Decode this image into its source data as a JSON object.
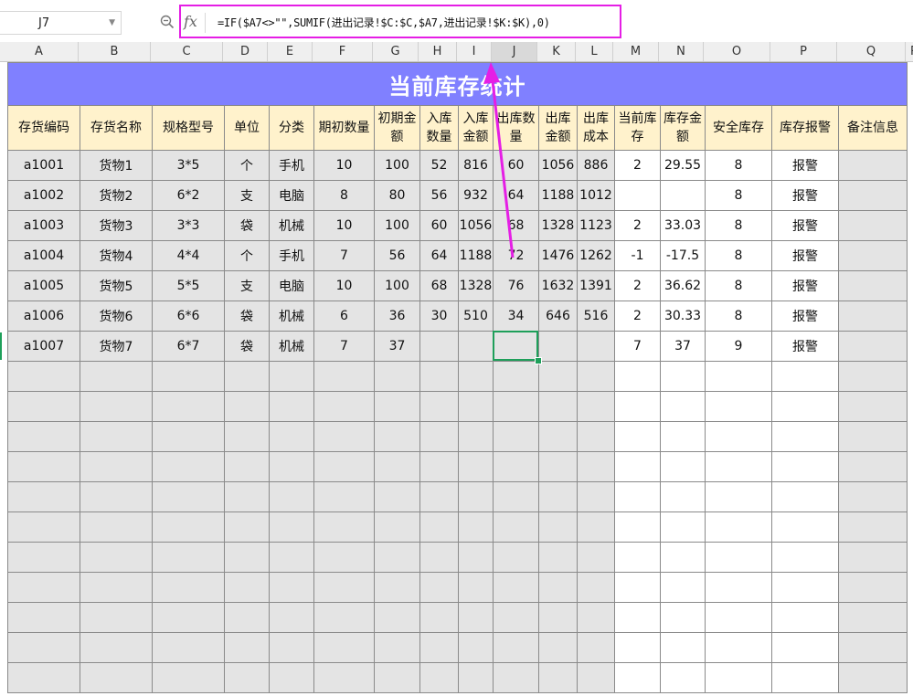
{
  "formula_bar": {
    "cell_ref": "J7",
    "fx_label": "fx",
    "formula": "=IF($A7<>\"\",SUMIF(进出记录!$C:$C,$A7,进出记录!$K:$K),0)"
  },
  "columns": [
    "A",
    "B",
    "C",
    "D",
    "E",
    "F",
    "G",
    "H",
    "I",
    "J",
    "K",
    "L",
    "M",
    "N",
    "O",
    "P",
    "Q",
    "R"
  ],
  "selected_column": "J",
  "sheet": {
    "title": "当前库存统计",
    "headers": [
      "存货编码",
      "存货名称",
      "规格型号",
      "单位",
      "分类",
      "期初数量",
      "初期金额",
      "入库数量",
      "入库金额",
      "出库数量",
      "出库金额",
      "出库成本",
      "当前库存",
      "库存金额",
      "安全库存",
      "库存报警",
      "备注信息"
    ],
    "rows": [
      [
        "a1001",
        "货物1",
        "3*5",
        "个",
        "手机",
        "10",
        "100",
        "52",
        "816",
        "60",
        "1056",
        "886",
        "2",
        "29.55",
        "8",
        "报警",
        ""
      ],
      [
        "a1002",
        "货物2",
        "6*2",
        "支",
        "电脑",
        "8",
        "80",
        "56",
        "932",
        "64",
        "1188",
        "1012",
        "",
        "",
        "8",
        "报警",
        ""
      ],
      [
        "a1003",
        "货物3",
        "3*3",
        "袋",
        "机械",
        "10",
        "100",
        "60",
        "1056",
        "68",
        "1328",
        "1123",
        "2",
        "33.03",
        "8",
        "报警",
        ""
      ],
      [
        "a1004",
        "货物4",
        "4*4",
        "个",
        "手机",
        "7",
        "56",
        "64",
        "1188",
        "72",
        "1476",
        "1262",
        "-1",
        "-17.5",
        "8",
        "报警",
        ""
      ],
      [
        "a1005",
        "货物5",
        "5*5",
        "支",
        "电脑",
        "10",
        "100",
        "68",
        "1328",
        "76",
        "1632",
        "1391",
        "2",
        "36.62",
        "8",
        "报警",
        ""
      ],
      [
        "a1006",
        "货物6",
        "6*6",
        "袋",
        "机械",
        "6",
        "36",
        "30",
        "510",
        "34",
        "646",
        "516",
        "2",
        "30.33",
        "8",
        "报警",
        ""
      ],
      [
        "a1007",
        "货物7",
        "6*7",
        "袋",
        "机械",
        "7",
        "37",
        "",
        "",
        "",
        "",
        "",
        "7",
        "37",
        "9",
        "报警",
        ""
      ]
    ]
  },
  "colors": {
    "title_bg": "#8080ff",
    "header_bg": "#fff2cc",
    "alarm_text": "#ee0000",
    "highlight_border": "#e51ee5",
    "active_cell": "#1e9f5a"
  }
}
